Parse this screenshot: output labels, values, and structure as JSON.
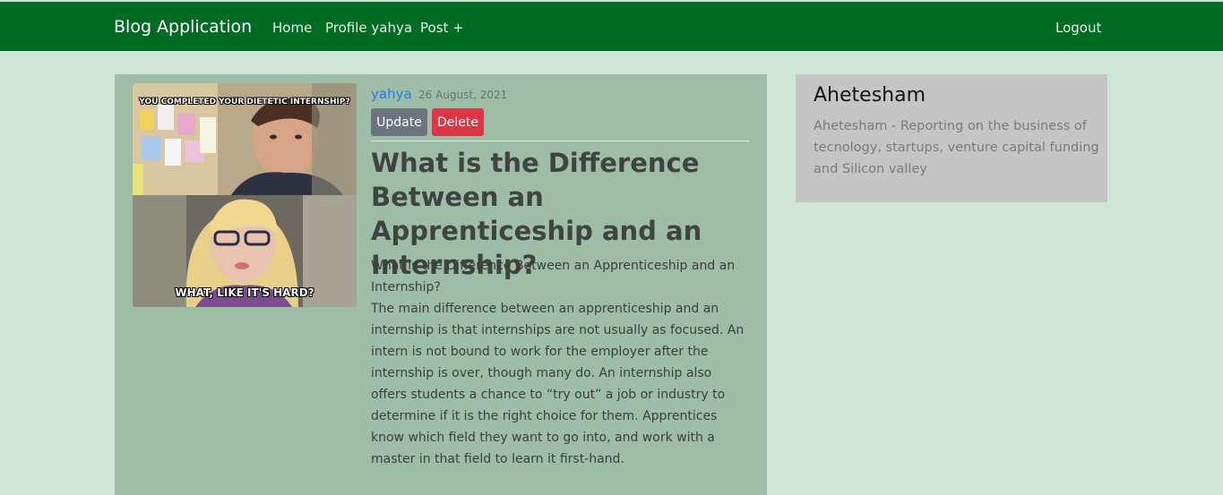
{
  "navbar": {
    "brand": "Blog Application",
    "links": [
      {
        "label": "Home"
      },
      {
        "label": "Profile yahya"
      },
      {
        "label": "Post +"
      }
    ],
    "logout_label": "Logout",
    "bg_color": "#006b22"
  },
  "post": {
    "image_top_text": "YOU COMPLETED YOUR DIETETIC INTERNSHIP?",
    "image_bottom_text": "WHAT, LIKE IT'S HARD?",
    "author": "yahya",
    "date": "26 August, 2021",
    "update_label": "Update",
    "delete_label": "Delete",
    "title": "What is the Difference Between an Apprenticeship and an Internship?",
    "body": "What is the Difference Between an Apprenticeship and an Internship?\nThe main difference between an apprenticeship and an internship is that internships are not usually as focused. An intern is not bound to work for the employer after the internship is over, though many do. An internship also offers students a chance to “try out” a job or industry to determine if it is the right choice for them. Apprentices know which field they want to go into, and work with a master in that field to learn it first-hand."
  },
  "profile": {
    "name": "Ahetesham",
    "bio": "Ahetesham - Reporting on the business of tecnology, startups, venture capital funding and Silicon valley"
  }
}
